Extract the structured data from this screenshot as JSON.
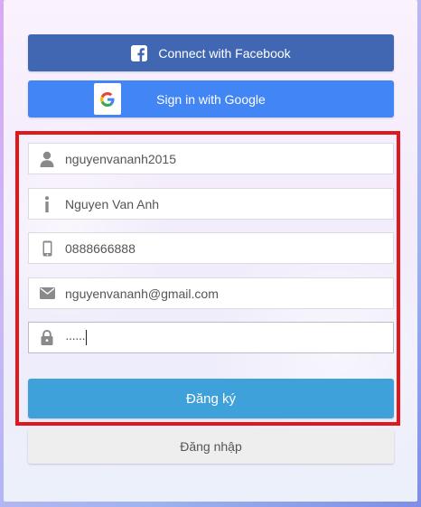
{
  "social": {
    "facebook_label": "Connect with Facebook",
    "google_label": "Sign in with Google"
  },
  "form": {
    "username": {
      "value": "nguyenvananh2015",
      "icon": "user-icon"
    },
    "fullname": {
      "value": "Nguyen Van Anh",
      "icon": "info-icon"
    },
    "phone": {
      "value": "0888666888",
      "icon": "phone-icon"
    },
    "email": {
      "value": "nguyenvananh@gmail.com",
      "icon": "mail-icon"
    },
    "password": {
      "value": "······",
      "icon": "lock-icon"
    }
  },
  "actions": {
    "register_label": "Đăng ký",
    "login_label": "Đăng nhập"
  },
  "colors": {
    "facebook": "#4267b2",
    "google": "#4285f4",
    "register": "#3ea1d9",
    "highlight": "#e0171d"
  }
}
